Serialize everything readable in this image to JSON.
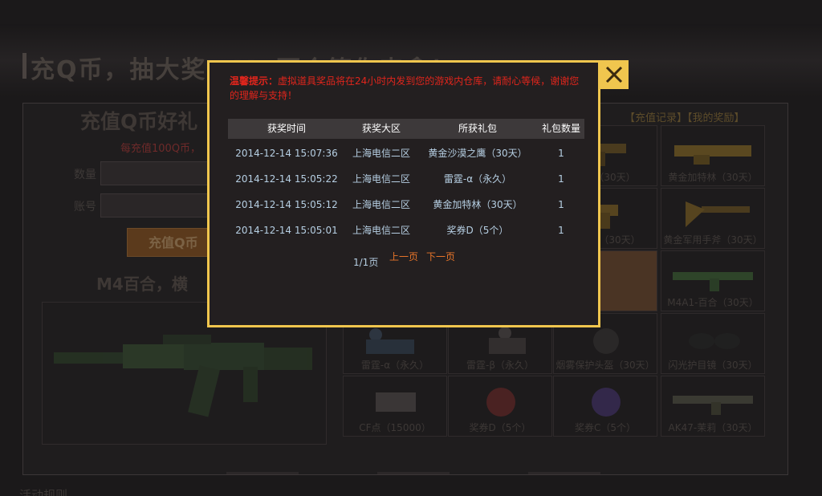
{
  "background": {
    "banner_title": "充Q币，抽大奖，M4百合等你来拿！",
    "left_title": "充值Q币好礼",
    "left_subtitle": "每充值100Q币，",
    "quantity_label": "数量",
    "account_label": "账号",
    "pay_button": "充值Q币",
    "left_subtitle2": "M4百合，横",
    "records_link": "【充值记录】",
    "rewards_link": "【我的奖励】",
    "footer_title": "活动规则",
    "grid_items": [
      {
        "label": "…迹（30天）"
      },
      {
        "label": "黄金加特林（30天）"
      },
      {
        "label": "…手枪（30天）"
      },
      {
        "label": "黄金军用手斧（30天）"
      },
      {
        "label": ""
      },
      {
        "label": "M4A1-百合（30天）"
      },
      {
        "label": "雷霆-α（永久）"
      },
      {
        "label": "雷霆-β（永久）"
      },
      {
        "label": "烟雾保护头盔（30天）"
      },
      {
        "label": "闪光护目镜（30天）"
      },
      {
        "label": "CF点（15000）"
      },
      {
        "label": "奖券D（5个）"
      },
      {
        "label": "奖券C（5个）"
      },
      {
        "label": "AK47-茉莉（30天）"
      }
    ]
  },
  "modal": {
    "tip_title": "温馨提示：",
    "tip_text": "虚拟道具奖品将在24小时内发到您的游戏内仓库，请耐心等候，谢谢您的理解与支持！",
    "columns": [
      "获奖时间",
      "获奖大区",
      "所获礼包",
      "礼包数量"
    ],
    "rows": [
      [
        "2014-12-14 15:07:36",
        "上海电信二区",
        "黄金沙漠之鹰（30天）",
        "1"
      ],
      [
        "2014-12-14 15:05:22",
        "上海电信二区",
        "雷霆-α（永久）",
        "1"
      ],
      [
        "2014-12-14 15:05:12",
        "上海电信二区",
        "黄金加特林（30天）",
        "1"
      ],
      [
        "2014-12-14 15:05:01",
        "上海电信二区",
        "奖券D（5个）",
        "1"
      ]
    ],
    "page_info": "1/1页",
    "prev_page": "上一页",
    "next_page": "下一页"
  },
  "colors": {
    "modal_border": "#f0c64e",
    "tip_red": "#e0251c",
    "pager_orange": "#e8752a",
    "cell_text": "#b6cfe3"
  }
}
